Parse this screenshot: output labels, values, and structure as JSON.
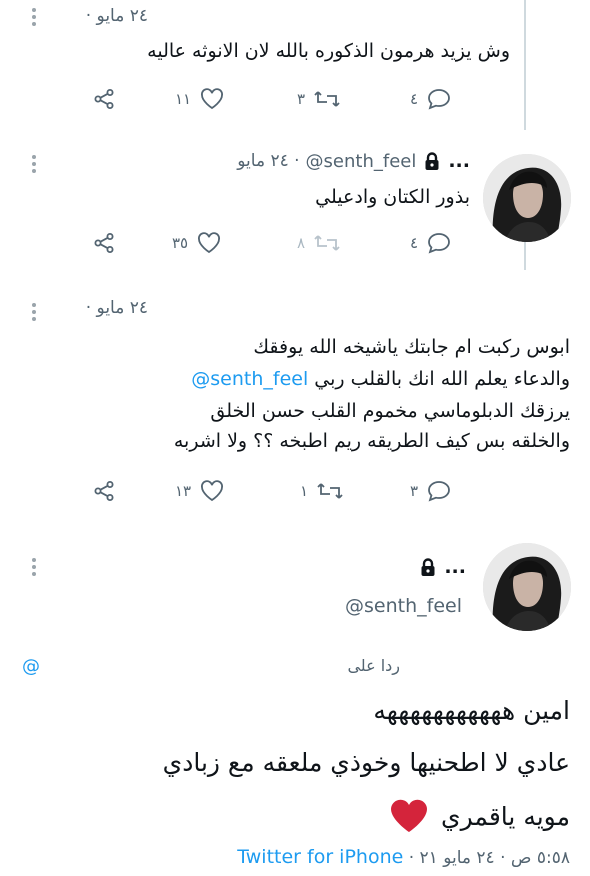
{
  "tweets": [
    {
      "date": "٢٤ مايو",
      "text": "وش يزيد هرمون الذكوره بالله لان الانوثه عاليه",
      "stats": {
        "replies": "٤",
        "retweets": "٣",
        "likes": "١١"
      }
    },
    {
      "name": "...",
      "handle": "@senth_feel",
      "date": "٢٤ مايو",
      "text": "بذور الكتان وادعيلي",
      "stats": {
        "replies": "٤",
        "retweets": "٨",
        "likes": "٣٥"
      }
    },
    {
      "date": "٢٤ مايو",
      "lines": [
        "ابوس ركبت ام جابتك ياشيخه الله يوفقك",
        "والدعاء يعلم الله انك بالقلب ربي",
        "يرزقك الدبلوماسي مخموم القلب حسن الخلق",
        "والخلقه بس كيف الطريقه ريم اطبخه ؟؟ ولا اشربه"
      ],
      "mention": "@senth_feel",
      "stats": {
        "replies": "٣",
        "retweets": "١",
        "likes": "١٣"
      }
    }
  ],
  "main": {
    "name": "...",
    "handle": "@senth_feel",
    "reply_to_label": "ردا على",
    "reply_to_handle": "@",
    "lines": [
      "امين هههههههههههه",
      "عادي لا اطحنيها وخوذي ملعقه مع زبادي",
      "مويه ياقمري"
    ],
    "time": "٥:٥٨ ص",
    "date": "٢٤ مايو ٢١",
    "source": "Twitter for iPhone"
  },
  "colors": {
    "accent": "#1d9bf0",
    "heart": "#e0245e",
    "muted": "#536471"
  },
  "icons": [
    "lock-icon",
    "reply-icon",
    "retweet-icon",
    "like-icon",
    "share-icon",
    "more-icon",
    "heart-emoji-icon"
  ]
}
